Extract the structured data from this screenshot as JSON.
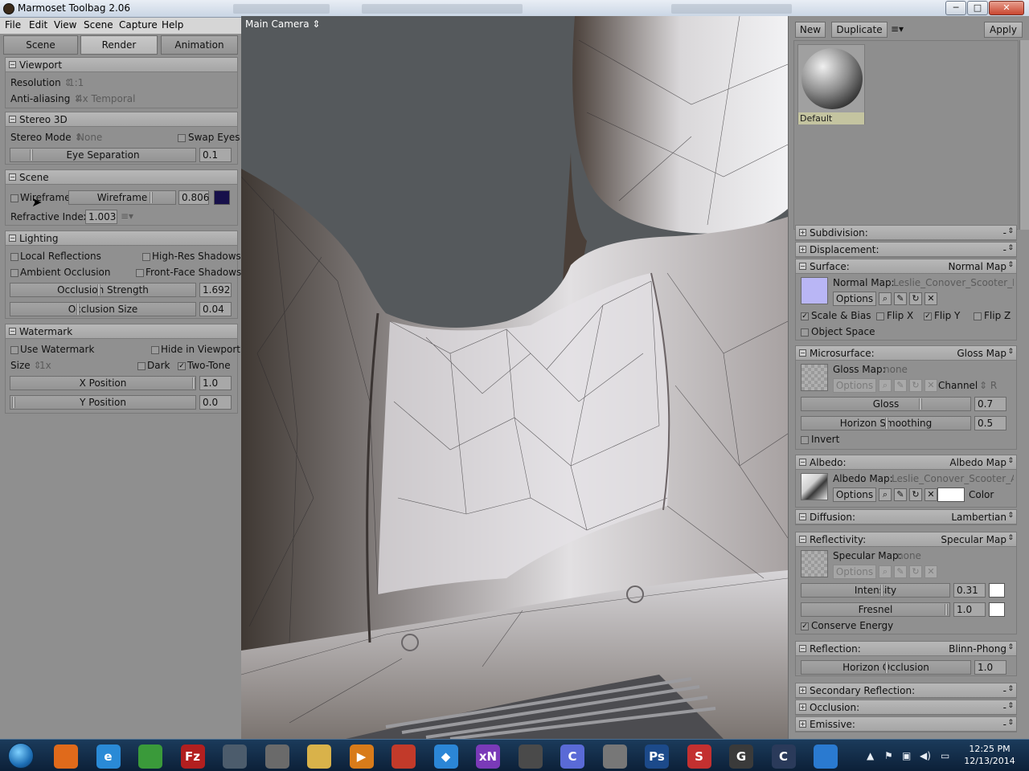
{
  "window": {
    "title": "Marmoset Toolbag 2.06",
    "controls": {
      "minimize": "─",
      "maximize": "□",
      "close": "✕"
    }
  },
  "menu": [
    "File",
    "Edit",
    "View",
    "Scene",
    "Capture",
    "Help"
  ],
  "left_tabs": [
    "Scene",
    "Render",
    "Animation"
  ],
  "viewport_section": {
    "title": "Viewport",
    "resolution_label": "Resolution",
    "resolution_value": "1:1",
    "aa_label": "Anti-aliasing",
    "aa_value": "4x Temporal"
  },
  "stereo_section": {
    "title": "Stereo 3D",
    "mode_label": "Stereo Mode",
    "mode_value": "None",
    "swap_eyes": "Swap Eyes",
    "eye_sep_label": "Eye Separation",
    "eye_sep_value": "0.1"
  },
  "scene_section": {
    "title": "Scene",
    "wireframe_check": "Wireframe",
    "wireframe_slider": "Wireframe",
    "wireframe_value": "0.806",
    "wireframe_color": "#17104a",
    "refractive_label": "Refractive Index:",
    "refractive_value": "1.003"
  },
  "lighting_section": {
    "title": "Lighting",
    "local_reflections": "Local Reflections",
    "hires_shadows": "High-Res Shadows",
    "ambient_occlusion": "Ambient Occlusion",
    "front_face_shadows": "Front-Face Shadows",
    "occ_strength_label": "Occlusion Strength",
    "occ_strength_value": "1.692",
    "occ_size_label": "Occlusion Size",
    "occ_size_value": "0.04"
  },
  "watermark_section": {
    "title": "Watermark",
    "use_watermark": "Use Watermark",
    "hide_in_viewport": "Hide in Viewport",
    "size_label": "Size",
    "size_value": "1x",
    "dark": "Dark",
    "two_tone": "Two-Tone",
    "x_label": "X Position",
    "x_value": "1.0",
    "y_label": "Y Position",
    "y_value": "0.0"
  },
  "viewport": {
    "camera": "Main Camera"
  },
  "right_toolbar": {
    "new": "New",
    "duplicate": "Duplicate",
    "apply": "Apply"
  },
  "material": {
    "name": "Default"
  },
  "subdivision": {
    "title": "Subdivision:",
    "value": "-"
  },
  "displacement": {
    "title": "Displacement:",
    "value": "-"
  },
  "surface": {
    "title": "Surface:",
    "mode": "Normal Map",
    "map_label": "Normal Map:",
    "map_value": "Leslie_Conover_Scooter_NM",
    "options": "Options",
    "scale_bias": "Scale & Bias",
    "flip_x": "Flip X",
    "flip_y": "Flip Y",
    "flip_z": "Flip Z",
    "object_space": "Object Space",
    "thumb_color": "#b9b6f5"
  },
  "microsurface": {
    "title": "Microsurface:",
    "mode": "Gloss Map",
    "map_label": "Gloss Map:",
    "map_value": "none",
    "options": "Options",
    "channel_label": "Channel",
    "channel_value": "R",
    "gloss_label": "Gloss",
    "gloss_value": "0.7",
    "horizon_label": "Horizon Smoothing",
    "horizon_value": "0.5",
    "invert": "Invert"
  },
  "albedo": {
    "title": "Albedo:",
    "mode": "Albedo Map",
    "map_label": "Albedo Map:",
    "map_value": "Leslie_Conover_Scooter_AO_",
    "options": "Options",
    "color_label": "Color"
  },
  "diffusion": {
    "title": "Diffusion:",
    "mode": "Lambertian"
  },
  "reflectivity": {
    "title": "Reflectivity:",
    "mode": "Specular Map",
    "map_label": "Specular Map:",
    "map_value": "none",
    "options": "Options",
    "intensity_label": "Intensity",
    "intensity_value": "0.31",
    "fresnel_label": "Fresnel",
    "fresnel_value": "1.0",
    "conserve_energy": "Conserve Energy"
  },
  "reflection": {
    "title": "Reflection:",
    "mode": "Blinn-Phong",
    "horizon_label": "Horizon Occlusion",
    "horizon_value": "1.0"
  },
  "secondary_reflection": {
    "title": "Secondary Reflection:",
    "value": "-"
  },
  "occlusion": {
    "title": "Occlusion:",
    "value": "-"
  },
  "emissive": {
    "title": "Emissive:",
    "value": "-"
  },
  "taskbar": {
    "apps": [
      {
        "name": "firefox",
        "glyph": "",
        "color": "#e06a1b"
      },
      {
        "name": "internet-explorer",
        "glyph": "e",
        "color": "#2a8ad6"
      },
      {
        "name": "chrome",
        "glyph": "",
        "color": "#3a9a3a"
      },
      {
        "name": "filezilla",
        "glyph": "Fz",
        "color": "#b21f1f"
      },
      {
        "name": "search-tool",
        "glyph": "",
        "color": "#4c5c6c"
      },
      {
        "name": "gimp",
        "glyph": "",
        "color": "#6a6a6a"
      },
      {
        "name": "explorer",
        "glyph": "",
        "color": "#d9b24a"
      },
      {
        "name": "media-player",
        "glyph": "▶",
        "color": "#d87b1a"
      },
      {
        "name": "ccleaner",
        "glyph": "",
        "color": "#c23a2a"
      },
      {
        "name": "dropbox",
        "glyph": "◆",
        "color": "#2b86d6"
      },
      {
        "name": "xnview",
        "glyph": "xN",
        "color": "#7a3ab8"
      },
      {
        "name": "marmoset",
        "glyph": "",
        "color": "#4a4a4a"
      },
      {
        "name": "cinema4d",
        "glyph": "C",
        "color": "#5a6ad6"
      },
      {
        "name": "zbrush",
        "glyph": "",
        "color": "#777777"
      },
      {
        "name": "photoshop",
        "glyph": "Ps",
        "color": "#1c4a8a"
      },
      {
        "name": "substance",
        "glyph": "S",
        "color": "#c33030"
      },
      {
        "name": "app-g",
        "glyph": "G",
        "color": "#3a3a3a"
      },
      {
        "name": "app-c",
        "glyph": "C",
        "color": "#2a3a5a"
      },
      {
        "name": "app-lens",
        "glyph": "",
        "color": "#2a7ad0"
      }
    ],
    "time": "12:25 PM",
    "date": "12/13/2014"
  }
}
